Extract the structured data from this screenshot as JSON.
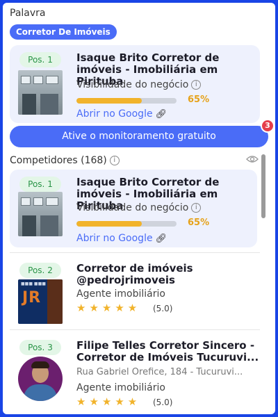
{
  "keyword": {
    "label": "Palavra",
    "chip": "Corretor De Imóveis"
  },
  "own_card": {
    "position": "Pos. 1",
    "title": "Isaque Brito Corretor de imóveis - Imobiliária em Pirituba",
    "subtitle": "Visibilidade do negócio",
    "visibility_pct": 65,
    "visibility_label": "65%",
    "link_label": "Abrir no Google",
    "bar_color": "#f1b32b"
  },
  "cta": {
    "label": "Ative o monitoramento gratuito",
    "badge": "3"
  },
  "competitors": {
    "title": "Competidores (168)",
    "items": [
      {
        "position": "Pos. 1",
        "title": "Isaque Brito Corretor de imóveis - Imobiliária em Pirituba",
        "subtitle": "Visibilidade do negócio",
        "visibility_pct": 65,
        "visibility_label": "65%",
        "link_label": "Abrir no Google"
      },
      {
        "position": "Pos. 2",
        "title": "Corretor de imóveis @pedrojrimoveis",
        "category": "Agente imobiliário",
        "stars": 5,
        "rating": "(5.0)",
        "thumb_text": "JR"
      },
      {
        "position": "Pos. 3",
        "title": "Filipe Telles Corretor Sincero - Corretor de Imóveis Tucuruvi...",
        "address": "Rua Gabriel Orefice, 184 - Tucuruvi...",
        "category": "Agente imobiliário",
        "stars": 5,
        "rating": "(5.0)"
      }
    ]
  },
  "colors": {
    "accent": "#4a6cf7",
    "badge_red": "#e53e4b",
    "pos_green": "#2a9447",
    "star": "#f1b32b"
  }
}
